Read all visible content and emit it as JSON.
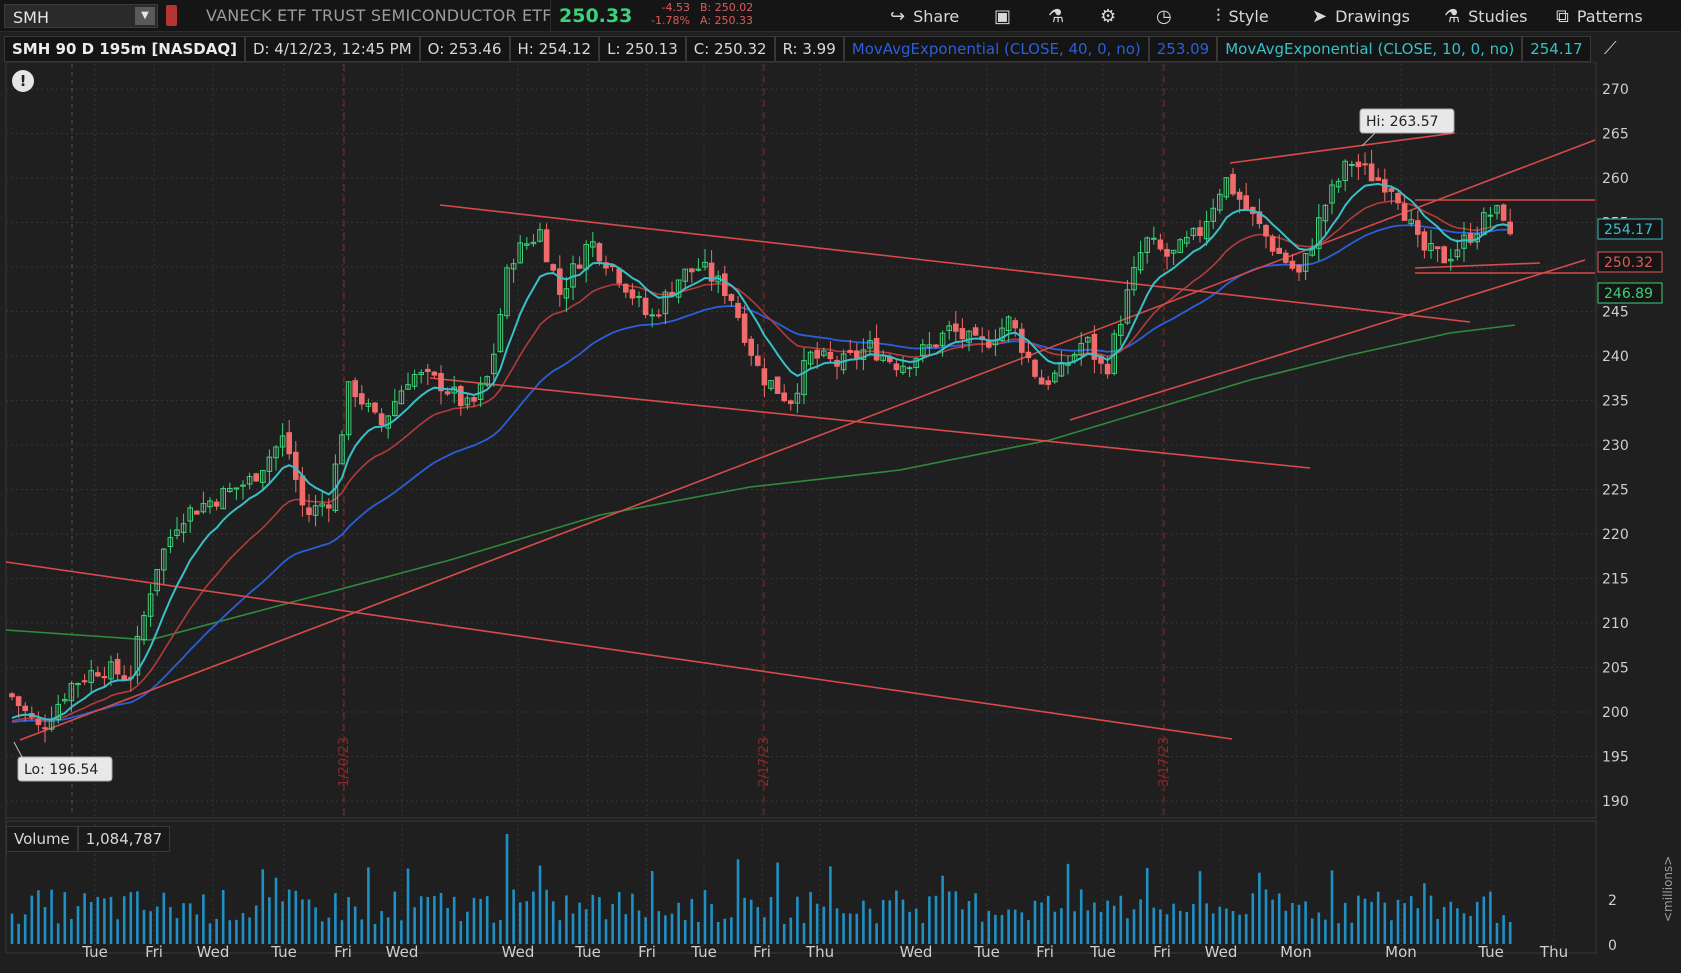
{
  "toolbar": {
    "symbol": "SMH",
    "company": "VANECK ETF TRUST SEMICONDUCTOR ETF",
    "last": "250.33",
    "change": "-4.53",
    "change_pct": "-1.78%",
    "bid": "B: 250.02",
    "ask": "A: 250.33",
    "share_label": "Share",
    "style_label": "Style",
    "drawings_label": "Drawings",
    "studies_label": "Studies",
    "patterns_label": "Patterns"
  },
  "header": {
    "title": "SMH 90 D 195m [NASDAQ]",
    "date": "D: 4/12/23, 12:45 PM",
    "open": "O: 253.46",
    "high": "H: 254.12",
    "low": "L: 250.13",
    "close": "C: 250.32",
    "range": "R: 3.99",
    "ma40": "MovAvgExponential (CLOSE, 40, 0, no)",
    "ma40_val": "253.09",
    "ma10": "MovAvgExponential (CLOSE, 10, 0, no)",
    "ma10_val": "254.17"
  },
  "volume": {
    "label": "Volume",
    "value": "1,084,787",
    "unit_label": "<millions>",
    "ticks": [
      "2",
      "0"
    ]
  },
  "chart_data": {
    "type": "candlestick",
    "ylim": [
      187,
      272
    ],
    "y_ticks": [
      270,
      265,
      260,
      255,
      250,
      245,
      240,
      235,
      230,
      225,
      220,
      215,
      210,
      205,
      200,
      195,
      190
    ],
    "x_labels": [
      "Tue",
      "Fri",
      "Wed",
      "Tue",
      "Fri",
      "Wed",
      "Wed",
      "Tue",
      "Fri",
      "Tue",
      "Fri",
      "Thu",
      "Wed",
      "Tue",
      "Fri",
      "Tue",
      "Fri",
      "Wed",
      "Mon",
      "Mon",
      "Tue",
      "Thu"
    ],
    "month_markers": [
      "1/20/23",
      "2/17/23",
      "3/17/23"
    ],
    "hi_label": "Hi: 263.57",
    "lo_label": "Lo: 196.54",
    "price_badges": [
      {
        "value": "254.17",
        "color": "#38c0c8"
      },
      {
        "value": "250.32",
        "color": "#e05a5a"
      },
      {
        "value": "246.89",
        "color": "#3ed07a"
      }
    ],
    "colors": {
      "up": "#3ed07a",
      "down": "#f06b6b",
      "ema10": "#38c0c8",
      "ema40": "#2b5fd9",
      "ema_red": "#b33b3b",
      "ema_green": "#2f8a3c",
      "trend": "#d94a4a",
      "volume": "#1f8fc4"
    }
  }
}
